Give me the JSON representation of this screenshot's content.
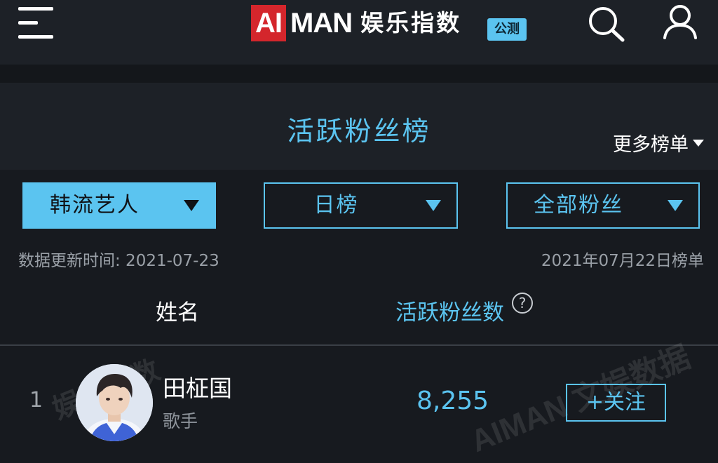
{
  "header": {
    "logo_ai": "AI",
    "logo_man": "MAN",
    "logo_cn": "娱乐指数",
    "beta_badge": "公测",
    "icons": [
      "menu-icon",
      "search-icon",
      "user-icon"
    ]
  },
  "board": {
    "title": "活跃粉丝榜",
    "more_label": "更多榜单"
  },
  "filters": [
    {
      "label": "韩流艺人",
      "active": true
    },
    {
      "label": "日榜",
      "active": false
    },
    {
      "label": "全部粉丝",
      "active": false
    }
  ],
  "update_time": "数据更新时间: 2021-07-23",
  "board_date": "2021年07月22日榜单",
  "columns": {
    "name": "姓名",
    "fans": "活跃粉丝数",
    "help": "?"
  },
  "rows": [
    {
      "rank": "1",
      "name": "田柾国",
      "role": "歌手",
      "fans": "8,255",
      "follow_label": "+关注"
    }
  ],
  "watermark": {
    "text_left": "娱乐指数",
    "text_right": "AIMAN 文娱数据"
  },
  "colors": {
    "accent": "#5bc4f0",
    "brand_red": "#d4262c",
    "background": "#171a1f",
    "panel": "#1d2127"
  }
}
